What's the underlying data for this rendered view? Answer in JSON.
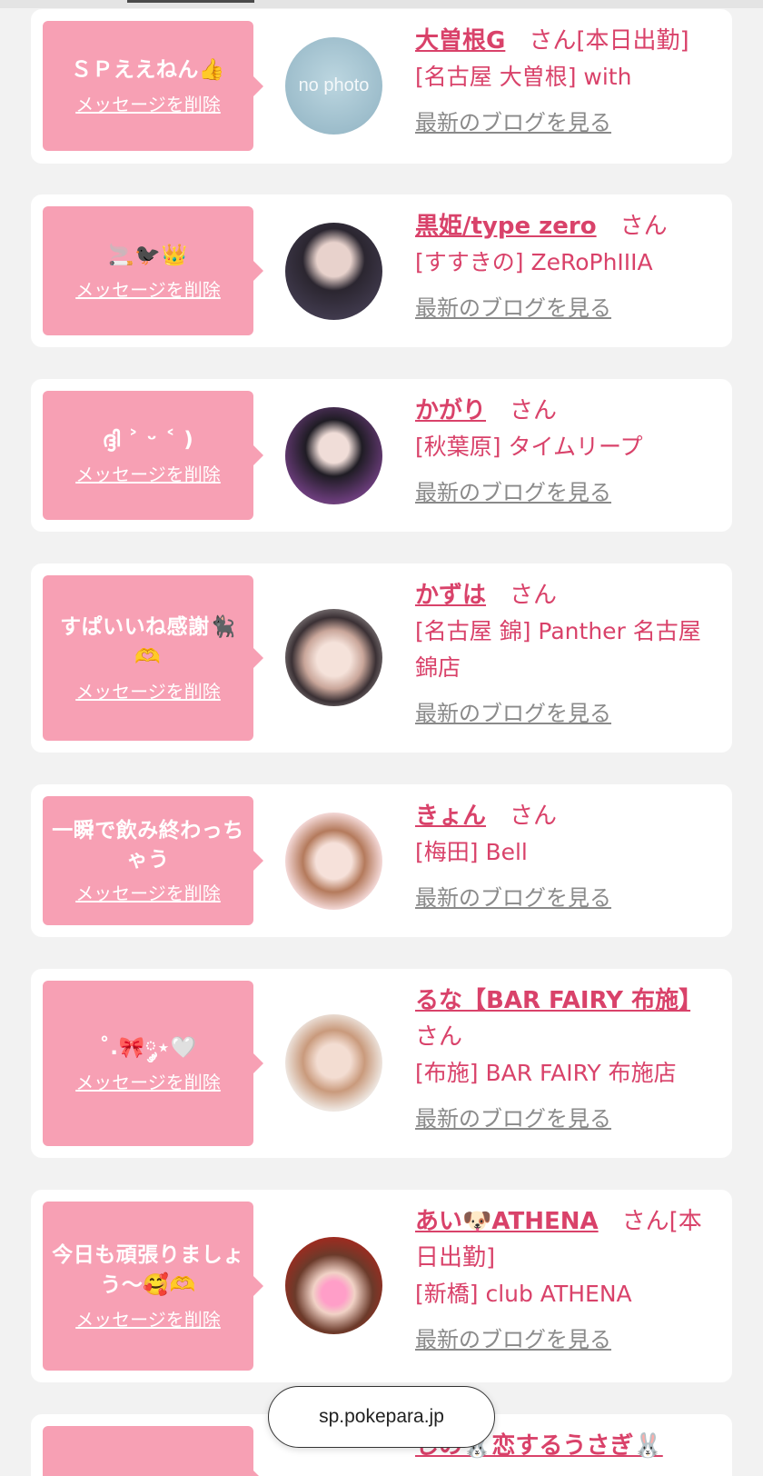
{
  "cards": [
    {
      "message": "ＳＰええねん👍",
      "delete_label": "メッセージを削除",
      "name": "大曽根G",
      "san": "さん",
      "shop": "[名古屋 大曽根] with",
      "blog": "最新のブログを見る",
      "avatar_text": "no photo",
      "name_suffix": "[本日出勤]"
    },
    {
      "message": "🚬🐦‍⬛👑",
      "delete_label": "メッセージを削除",
      "name": "黒姫/type zero",
      "san": "さん",
      "shop": "[すすきの] ZeRoPhIIIA",
      "blog": "最新のブログを見る"
    },
    {
      "message": "ദ്ദി ˃ ᵕ ˂ )",
      "delete_label": "メッセージを削除",
      "name": "かがり",
      "san": "さん",
      "shop": "[秋葉原] タイムリープ",
      "blog": "最新のブログを見る"
    },
    {
      "message": "すぱいいね感謝🐈‍⬛🫶",
      "delete_label": "メッセージを削除",
      "name": "かずは",
      "san": "さん",
      "shop": "[名古屋 錦] Panther 名古屋錦店",
      "blog": "最新のブログを見る"
    },
    {
      "message": "一瞬で飲み終わっちゃう",
      "delete_label": "メッセージを削除",
      "name": "きょん",
      "san": "さん",
      "shop": "[梅田] Bell",
      "blog": "最新のブログを見る"
    },
    {
      "message": "˚.🎀༘⋆🤍",
      "delete_label": "メッセージを削除",
      "name": "るな【BAR FAIRY 布施】",
      "san": "さん",
      "shop": "[布施] BAR FAIRY 布施店",
      "blog": "最新のブログを見る"
    },
    {
      "message": "今日も頑張りましょう〜🥰🫶",
      "delete_label": "メッセージを削除",
      "name": "あい🐶ATHENA",
      "san": "さん",
      "shop": "[新橋] club ATHENA",
      "blog": "最新のブログを見る",
      "name_suffix": "[本日出勤]"
    },
    {
      "name": "しの🐰恋するうさぎ🐰"
    }
  ],
  "browser": {
    "url": "sp.pokepara.jp"
  },
  "colors": {
    "accent": "#d9426a",
    "bubble": "#f7a0b4",
    "link_gray": "#8a8a8a"
  }
}
